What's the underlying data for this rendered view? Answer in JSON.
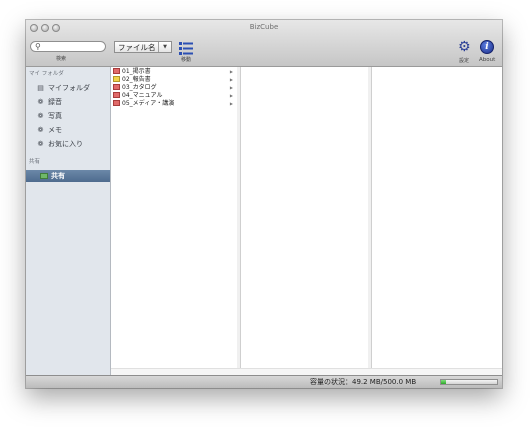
{
  "window": {
    "title": "BizCube"
  },
  "toolbar": {
    "search_placeholder": "",
    "search_label": "検索",
    "file_select_value": "ファイル名",
    "move_label": "移動",
    "settings_label": "設定",
    "about_label": "About"
  },
  "sidebar": {
    "my_folder_header": "マイ フォルダ",
    "items": [
      {
        "label": "マイフォルダ",
        "icon": "folder-icon"
      },
      {
        "label": "録音",
        "icon": "gear-icon"
      },
      {
        "label": "写真",
        "icon": "gear-icon"
      },
      {
        "label": "メモ",
        "icon": "gear-icon"
      },
      {
        "label": "お気に入り",
        "icon": "gear-icon"
      }
    ],
    "shared_header": "共有",
    "shared_item": {
      "label": "共有",
      "icon": "folder-icon"
    }
  },
  "files": [
    {
      "name": "01_掲示書",
      "color": "#e06a6a"
    },
    {
      "name": "02_報告書",
      "color": "#f2d44a"
    },
    {
      "name": "03_カタログ",
      "color": "#e06a6a"
    },
    {
      "name": "04_マニュアル",
      "color": "#e06a6a"
    },
    {
      "name": "05_メディア・講演",
      "color": "#e06a6a"
    }
  ],
  "status": {
    "capacity_text": "容量の状況：49.2 MB/500.0 MB",
    "capacity_fraction": 0.098
  }
}
